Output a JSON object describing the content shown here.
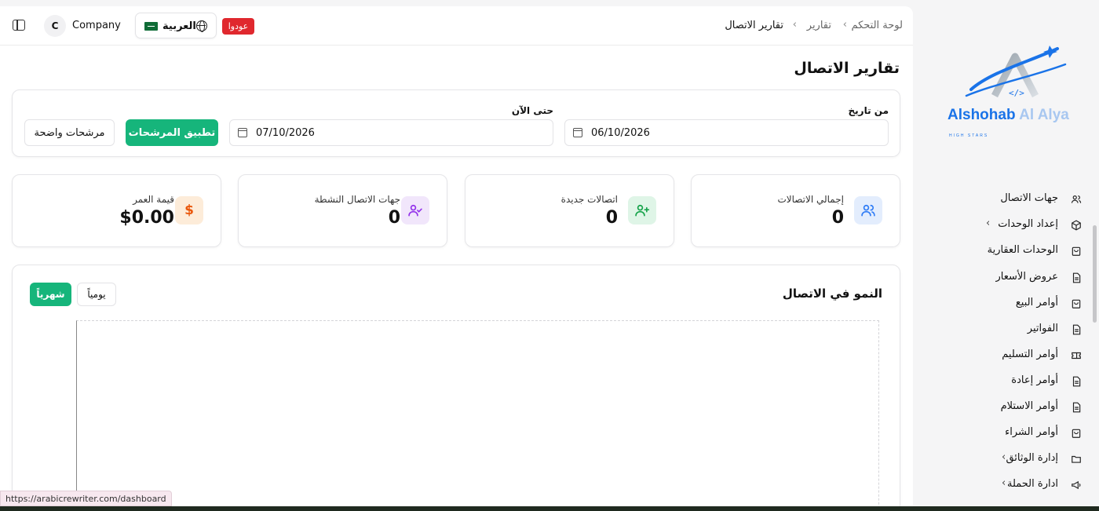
{
  "topbar": {
    "avatar_initial": "C",
    "company_name": "Company",
    "language_label": "العربية",
    "badge_label": "عودوا",
    "breadcrumb": {
      "home": "لوحة التحكم",
      "section": "تقارير",
      "current": "تقارير الاتصال",
      "separator": "‹"
    }
  },
  "page": {
    "title": "تقارير الاتصال"
  },
  "filters": {
    "from_label": "من تاريخ",
    "from_value": "06/10/2026",
    "to_label": "حتى الآن",
    "to_value": "07/10/2026",
    "apply_label": "تطبيق المرشحات",
    "clear_label": "مرشحات واضحة"
  },
  "stats": [
    {
      "label": "إجمالي الاتصالات",
      "value": "0",
      "icon": "users-icon",
      "color": "#2f7cf6"
    },
    {
      "label": "اتصالات جديدة",
      "value": "0",
      "icon": "user-plus-icon",
      "color": "#16a34a"
    },
    {
      "label": "جهات الاتصال النشطة",
      "value": "0",
      "icon": "user-check-icon",
      "color": "#9333ea"
    },
    {
      "label": "قيمة العمر",
      "value": "$0.00",
      "icon": "dollar-icon",
      "color": "#ea580c"
    }
  ],
  "chart": {
    "title": "النمو في الاتصال",
    "daily_label": "يومياً",
    "monthly_label": "شهرياً"
  },
  "chart_data": {
    "type": "line",
    "title": "النمو في الاتصال",
    "x": [],
    "series": []
  },
  "brand": {
    "logo_text": "Alshohab Al Alya",
    "logo_tagline": "HIGH STARS",
    "accent": "#1a73e8"
  },
  "sidebar": {
    "items": [
      {
        "label": "جهات الاتصال",
        "icon": "users-icon",
        "has_children": false
      },
      {
        "label": "إعداد الوحدات",
        "icon": "box-icon",
        "has_children": true
      },
      {
        "label": "الوحدات العقارية",
        "icon": "bag-icon",
        "has_children": false
      },
      {
        "label": "عروض الأسعار",
        "icon": "document-icon",
        "has_children": false
      },
      {
        "label": "أوامر البيع",
        "icon": "bag-icon",
        "has_children": false
      },
      {
        "label": "الفواتير",
        "icon": "document-icon",
        "has_children": false
      },
      {
        "label": "أوامر التسليم",
        "icon": "ticket-icon",
        "has_children": false
      },
      {
        "label": "أوامر إعادة",
        "icon": "document-icon",
        "has_children": false
      },
      {
        "label": "أوامر الاستلام",
        "icon": "document-icon",
        "has_children": false
      },
      {
        "label": "أوامر الشراء",
        "icon": "bag-icon",
        "has_children": false
      },
      {
        "label": "إدارة الوثائق",
        "icon": "folder-icon",
        "has_children": true
      },
      {
        "label": "ادارة الحملة",
        "icon": "megaphone-icon",
        "has_children": true
      }
    ]
  },
  "status_bar": {
    "url": "https://arabicrewriter.com/dashboard"
  },
  "colors": {
    "primary_green": "#16b57b",
    "badge_red": "#e0282e"
  }
}
